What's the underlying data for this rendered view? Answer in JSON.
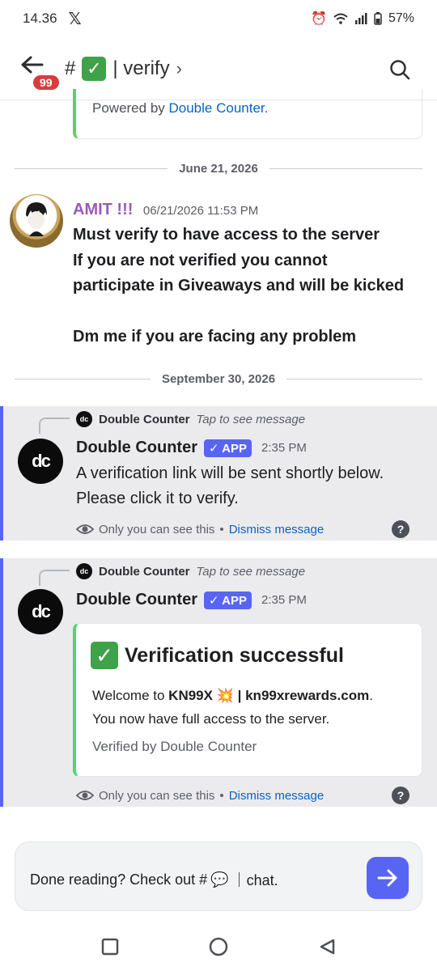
{
  "status": {
    "time": "14.36",
    "battery": "57%"
  },
  "header": {
    "unread_badge": "99",
    "channel_hash": "#",
    "channel_sep": "| verify",
    "chevron": "›"
  },
  "prev_embed": {
    "powered_prefix": "Powered by ",
    "powered_link": "Double Counter",
    "powered_suffix": "."
  },
  "dividers": {
    "first": "June 21, 2026",
    "second": "September 30, 2026"
  },
  "amit_message": {
    "username": "AMIT !!!",
    "timestamp": "06/21/2026 11:53 PM",
    "lines": [
      "Must verify to have access to the server",
      "If you are not verified you cannot",
      "participate in Giveaways and will be kicked",
      "",
      "Dm me if you are facing any problem"
    ]
  },
  "ephemeral_1": {
    "reply_name": "Double Counter",
    "reply_hint": "Tap to see message",
    "bot_name": "Double Counter",
    "app_tag": "✓ APP",
    "timestamp": "2:35 PM",
    "text_line1": "A verification link will be sent shortly below.",
    "text_line2": "Please click it to verify.",
    "only_you": "Only you can see this",
    "dot": " • ",
    "dismiss": "Dismiss message"
  },
  "ephemeral_2": {
    "reply_name": "Double Counter",
    "reply_hint": "Tap to see message",
    "bot_name": "Double Counter",
    "app_tag": "✓ APP",
    "timestamp": "2:35 PM",
    "embed_title": "Verification successful",
    "embed_welcome": "Welcome to ",
    "embed_server": "KN99X",
    "embed_emoji": "💥",
    "embed_site": "| kn99xrewards.com",
    "embed_site_end": ".",
    "embed_line2": "You now have full access to the server.",
    "embed_footer": "Verified by Double Counter",
    "only_you": "Only you can see this",
    "dot": " • ",
    "dismiss": "Dismiss message"
  },
  "composer": {
    "prefix": "Done reading? Check out #",
    "emoji": "💬",
    "suffix": "｜chat."
  },
  "avatars": {
    "double_counter": "dc",
    "double_counter_mini": "dc"
  },
  "colors": {
    "accent": "#5865f2",
    "success": "#57d36b",
    "amit": "#9b59b6",
    "link": "#0b63c1"
  }
}
